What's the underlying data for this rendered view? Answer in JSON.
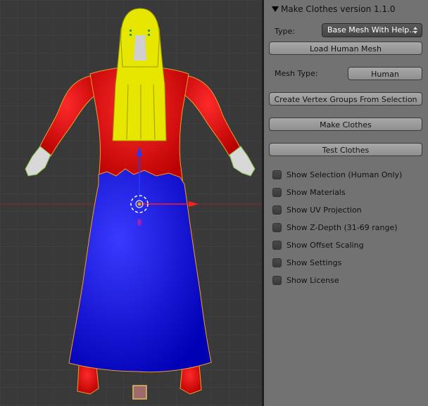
{
  "panel": {
    "title": "Make Clothes version 1.1.0",
    "type_label": "Type:",
    "type_value": "Base Mesh  With Help...",
    "load_button": "Load Human Mesh",
    "mesh_type_label": "Mesh Type:",
    "mesh_type_value": "Human",
    "create_vgroups_button": "Create Vertex Groups From Selection",
    "make_clothes_button": "Make Clothes",
    "test_clothes_button": "Test Clothes",
    "checkboxes": [
      {
        "label": "Show Selection (Human Only)",
        "checked": false
      },
      {
        "label": "Show Materials",
        "checked": false
      },
      {
        "label": "Show UV Projection",
        "checked": false
      },
      {
        "label": "Show Z-Depth (31-69 range)",
        "checked": false
      },
      {
        "label": "Show Offset Scaling",
        "checked": false
      },
      {
        "label": "Show Settings",
        "checked": false
      },
      {
        "label": "Show License",
        "checked": false
      }
    ]
  },
  "viewport": {
    "background": "#393939",
    "model_colors": {
      "top": "#e00000",
      "skirt": "#0000dd",
      "hair": "#e6e600",
      "hands": "#d8d8d8"
    }
  }
}
